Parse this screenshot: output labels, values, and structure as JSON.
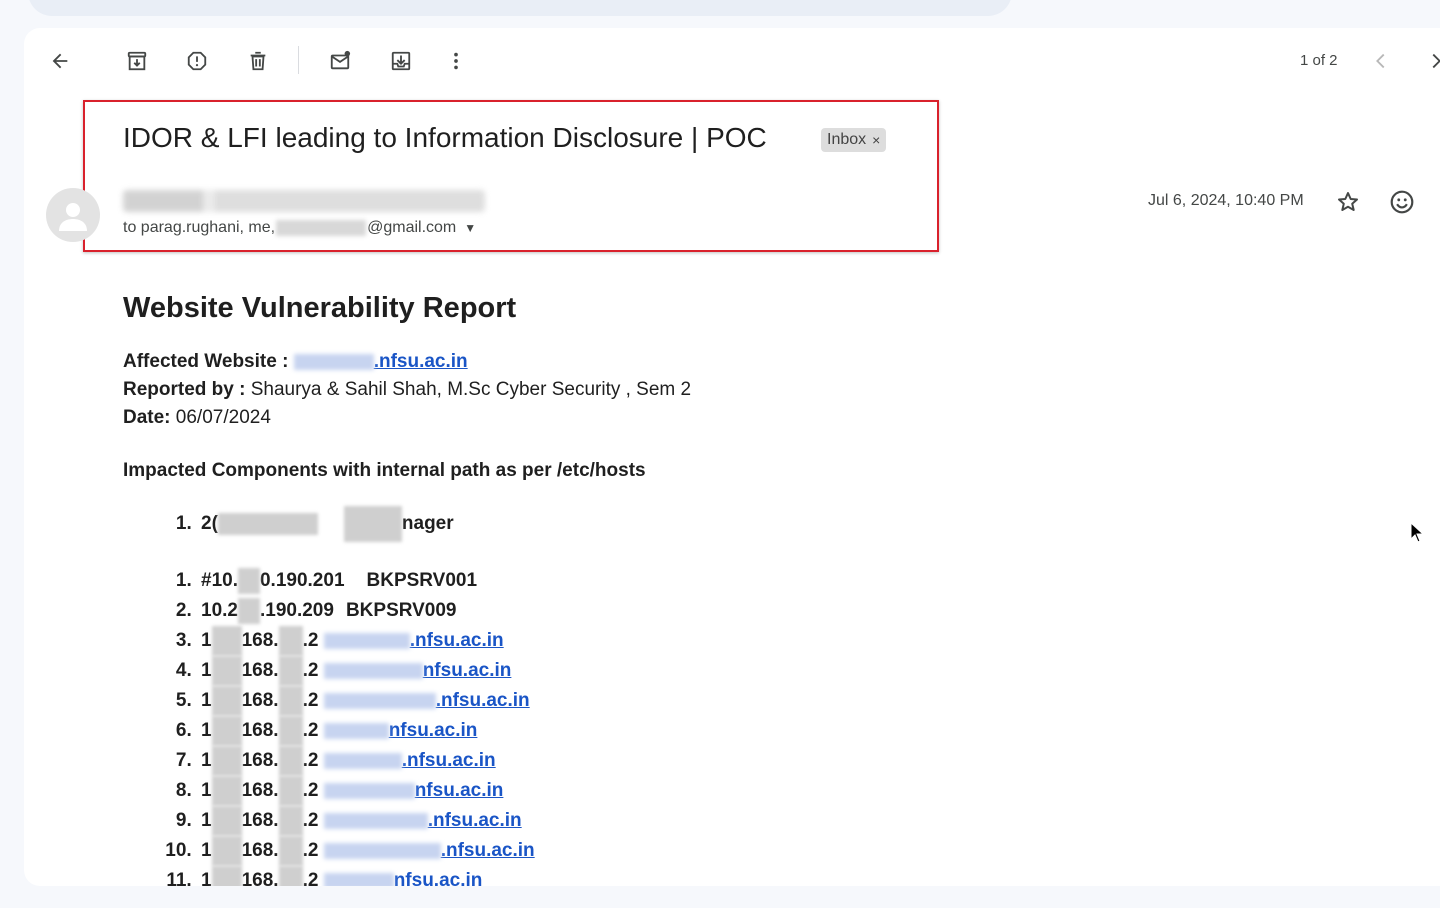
{
  "toolbar": {
    "pager": "1 of 2"
  },
  "message": {
    "subject": "IDOR & LFI leading to Information Disclosure | POC",
    "label_chip": "Inbox",
    "chip_close": "×",
    "recipients_prefix": "to parag.rughani, me, ",
    "recipients_suffix": "@gmail.com",
    "date": "Jul 6, 2024, 10:40 PM"
  },
  "report": {
    "title": "Website Vulnerability Report",
    "affected_label": "Affected Website : ",
    "affected_domain_suffix": ".nfsu.ac.in",
    "reported_label": "Reported by : ",
    "reported_value": "Shaurya & Sahil Shah, M.Sc Cyber Security , Sem 2",
    "date_label": "Date: ",
    "date_value": "06/07/2024",
    "section_heading": "Impacted Components with internal path as per /etc/hosts",
    "component_item_prefix": "2(",
    "component_item_suffix": "nager",
    "hosts": [
      {
        "ip_prefix": "#10.",
        "ip_suffix": "0.190.201",
        "name": "BKPSRV001"
      },
      {
        "ip_prefix": "10.2",
        "ip_suffix": ".190.209",
        "name": "BKPSRV009"
      },
      {
        "ip_prefix": "1",
        "ip_suffix": "168.",
        "ip_end": ".2",
        "domain_suffix": ".nfsu.ac.in"
      },
      {
        "ip_prefix": "1",
        "ip_suffix": "168.",
        "ip_end": ".2",
        "domain_suffix": "nfsu.ac.in"
      },
      {
        "ip_prefix": "1",
        "ip_suffix": "168.",
        "ip_end": ".2",
        "domain_suffix": ".nfsu.ac.in"
      },
      {
        "ip_prefix": "1",
        "ip_suffix": "168.",
        "ip_end": ".2",
        "domain_suffix": "nfsu.ac.in"
      },
      {
        "ip_prefix": "1",
        "ip_suffix": "168.",
        "ip_end": ".2",
        "domain_suffix": ".nfsu.ac.in"
      },
      {
        "ip_prefix": "1",
        "ip_suffix": "168.",
        "ip_end": ".2",
        "domain_suffix": "nfsu.ac.in"
      },
      {
        "ip_prefix": "1",
        "ip_suffix": "168.",
        "ip_end": ".2",
        "domain_suffix": ".nfsu.ac.in"
      },
      {
        "ip_prefix": "1",
        "ip_suffix": "168.",
        "ip_end": ".2",
        "domain_suffix": ".nfsu.ac.in"
      },
      {
        "ip_prefix": "1",
        "ip_suffix": "168.",
        "ip_end": ".2",
        "domain_suffix": "nfsu.ac.in"
      }
    ]
  },
  "colors": {
    "highlight_border": "#d9212c",
    "link": "#1a55c6",
    "background": "#f6f8fc"
  }
}
